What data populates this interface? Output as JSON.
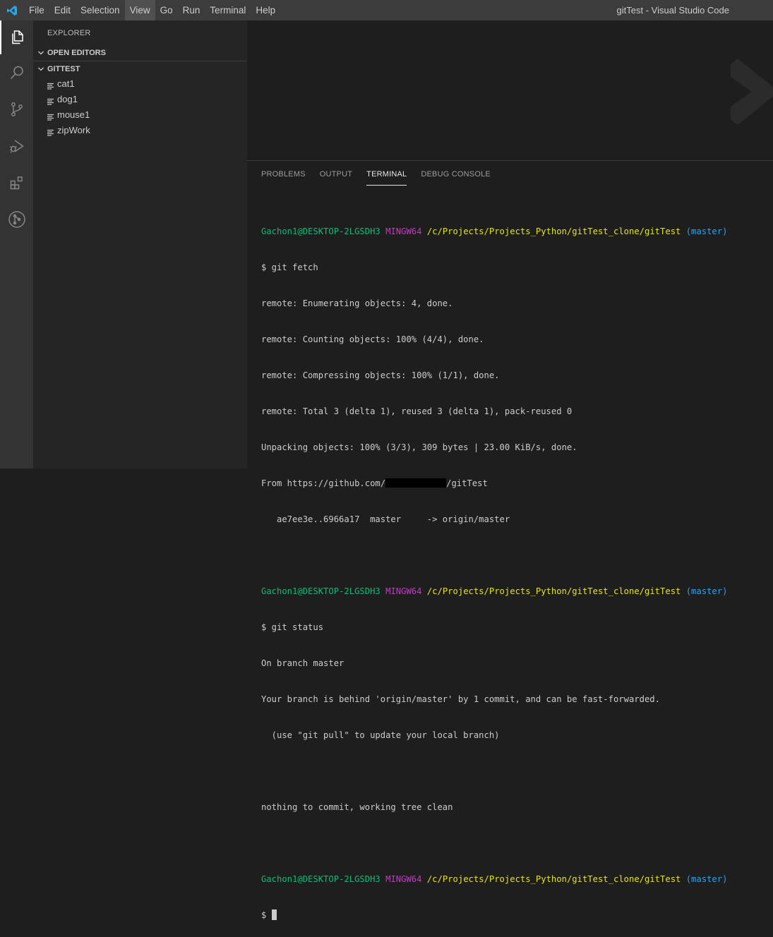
{
  "titlebar": {
    "menu": [
      "File",
      "Edit",
      "Selection",
      "View",
      "Go",
      "Run",
      "Terminal",
      "Help"
    ],
    "active_menu": "View",
    "window_title": "gitTest - Visual Studio Code",
    "logo_color": "#23a9f2"
  },
  "activity_bar": {
    "icons": [
      "explorer-icon",
      "search-icon",
      "source-control-icon",
      "run-debug-icon",
      "extensions-icon",
      "git-graph-icon"
    ],
    "active": "explorer-icon"
  },
  "sidebar": {
    "title": "EXPLORER",
    "open_editors": "OPEN EDITORS",
    "folder": "GITTEST",
    "files": [
      {
        "name": "cat1"
      },
      {
        "name": "dog1"
      },
      {
        "name": "mouse1"
      },
      {
        "name": "zipWork"
      }
    ]
  },
  "panel": {
    "tabs": [
      "PROBLEMS",
      "OUTPUT",
      "TERMINAL",
      "DEBUG CONSOLE"
    ],
    "active_tab": "TERMINAL"
  },
  "terminal": {
    "user": "Gachon1@DESKTOP-2LGSDH3",
    "env": "MINGW64",
    "path": "/c/Projects/Projects_Python/gitTest_clone/gitTest",
    "branch": "(master)",
    "cmd1": "$ git fetch",
    "out1": [
      "remote: Enumerating objects: 4, done.",
      "remote: Counting objects: 100% (4/4), done.",
      "remote: Compressing objects: 100% (1/1), done.",
      "remote: Total 3 (delta 1), reused 3 (delta 1), pack-reused 0",
      "Unpacking objects: 100% (3/3), 309 bytes | 23.00 KiB/s, done."
    ],
    "from_prefix": "From https://github.com/",
    "from_suffix": "/gitTest",
    "ref_update": "   ae7ee3e..6966a17  master     -> origin/master",
    "cmd2": "$ git status",
    "out2": [
      "On branch master",
      "Your branch is behind 'origin/master' by 1 commit, and can be fast-forwarded.",
      "  (use \"git pull\" to update your local branch)",
      "",
      "nothing to commit, working tree clean"
    ],
    "prompt": "$ "
  }
}
